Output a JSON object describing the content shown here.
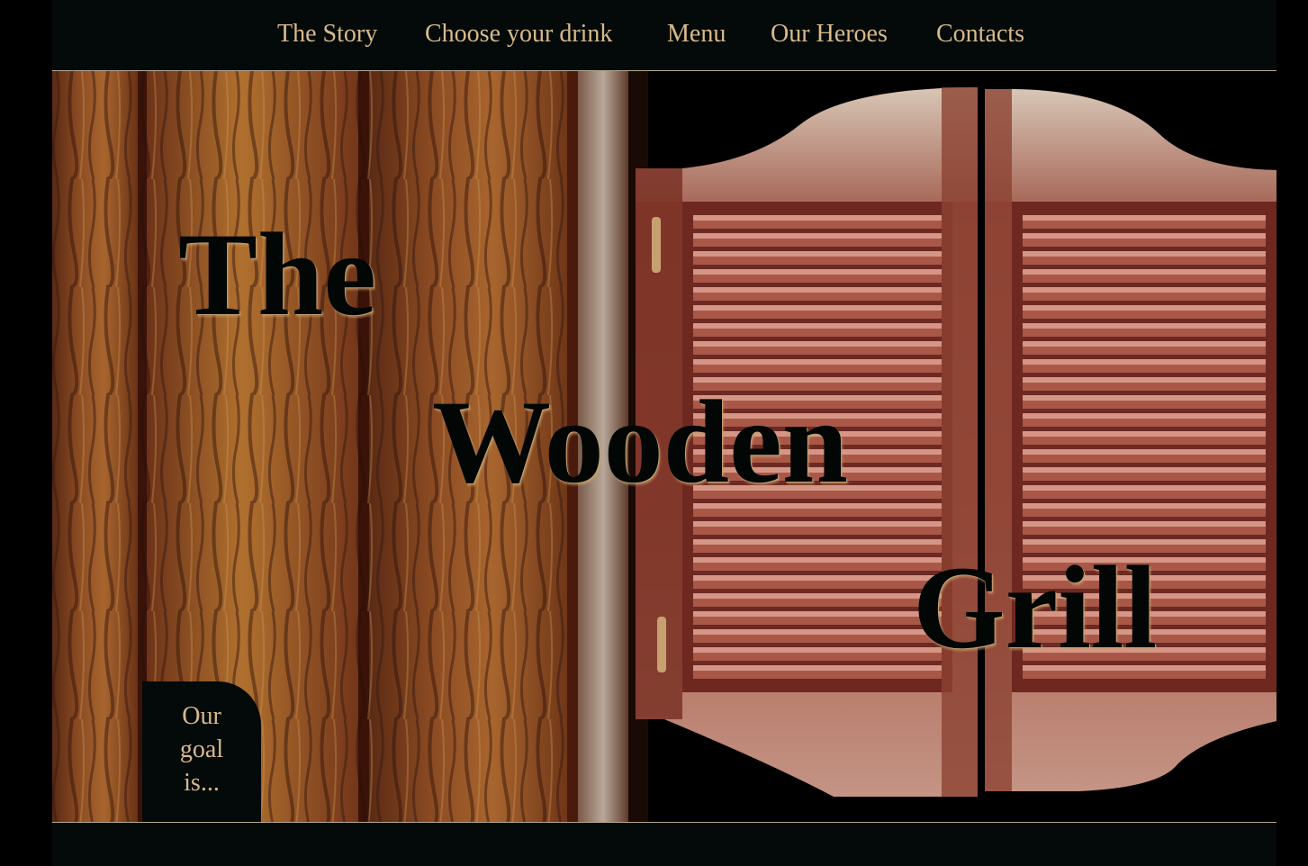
{
  "nav": {
    "items": [
      {
        "label": "The Story"
      },
      {
        "label": "Choose your drink"
      },
      {
        "label": "Menu"
      },
      {
        "label": "Our Heroes"
      },
      {
        "label": "Contacts"
      }
    ]
  },
  "hero": {
    "title_words": [
      "The",
      "Wooden",
      "Grill"
    ],
    "goal_badge": {
      "lines": [
        "Our",
        "goal",
        "is..."
      ]
    }
  },
  "colors": {
    "page_background": "#000000",
    "nav_background": "#040a09",
    "nav_text": "#d9b98a",
    "title_text": "#020705",
    "divider": "#b8a890"
  }
}
